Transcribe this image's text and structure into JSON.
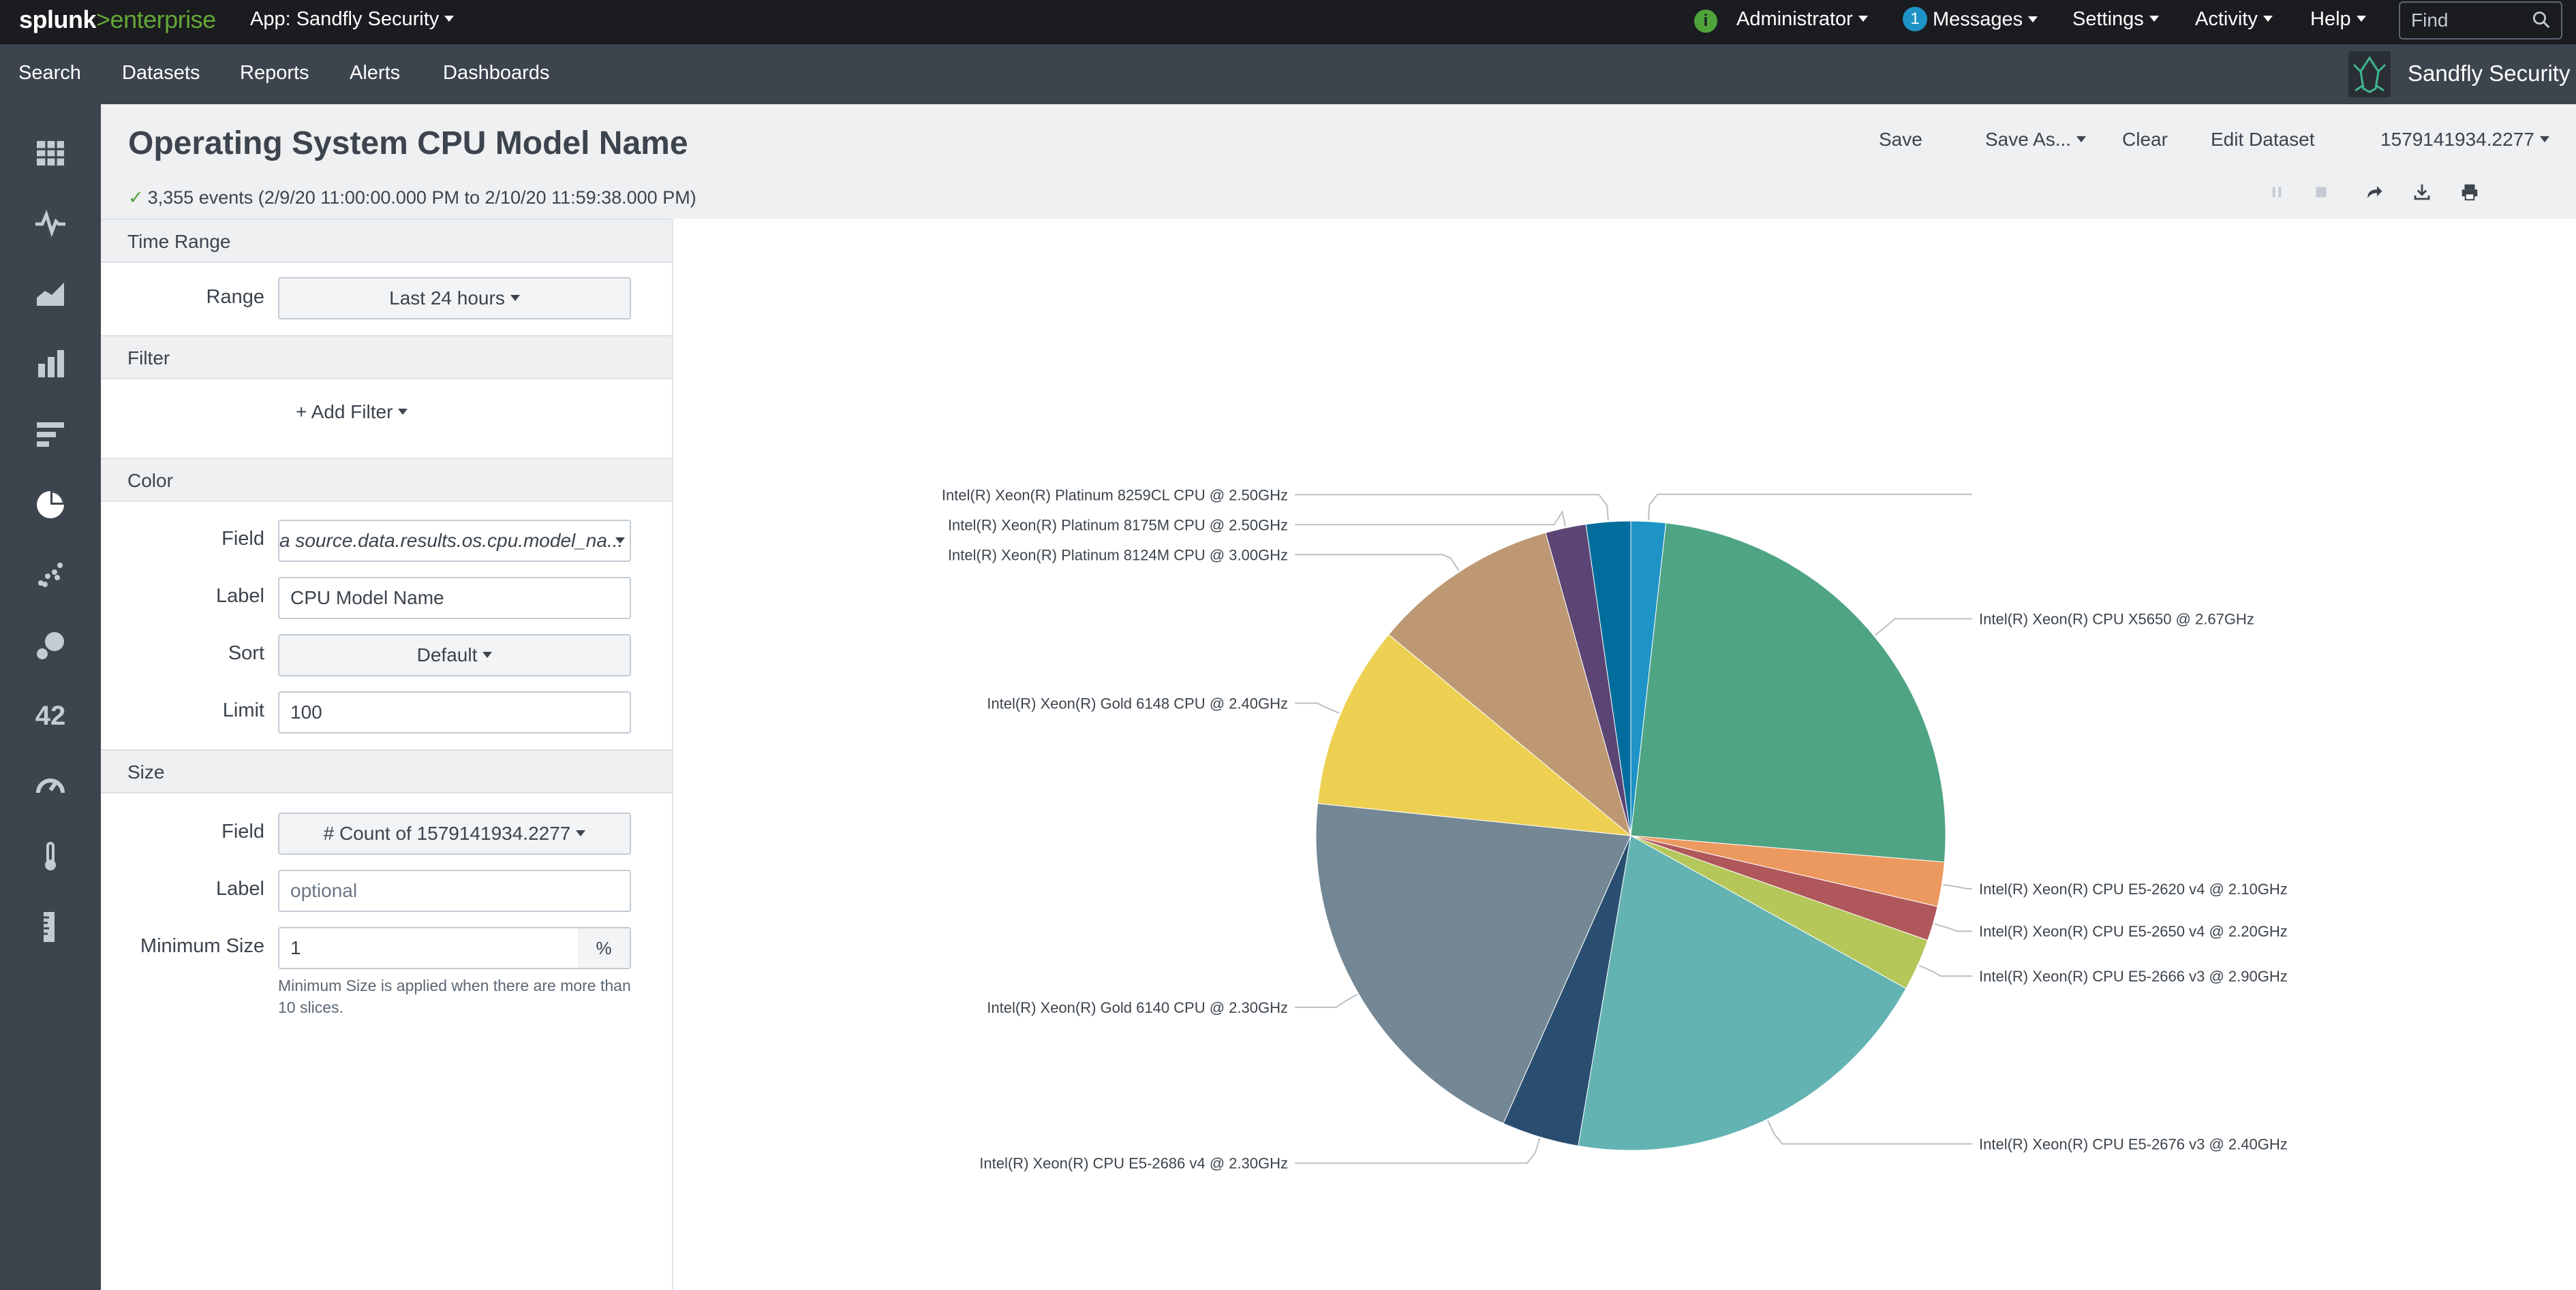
{
  "topbar": {
    "logo_part1": "splunk",
    "logo_part2": ">",
    "logo_part3": "enterprise",
    "app_label": "App: Sandfly Security",
    "user": "Administrator",
    "messages_count": "1",
    "messages": "Messages",
    "settings": "Settings",
    "activity": "Activity",
    "help": "Help",
    "find_placeholder": "Find"
  },
  "appbar": {
    "nav": [
      "Search",
      "Datasets",
      "Reports",
      "Alerts",
      "Dashboards"
    ],
    "app_name": "Sandfly Security"
  },
  "rail": {
    "icons": [
      "table-icon",
      "pulse-icon",
      "area-chart-icon",
      "bar-chart-icon",
      "horizontal-bar-icon",
      "pie-chart-icon",
      "scatter-icon",
      "bubble-icon",
      "single-value-icon",
      "gauge-icon",
      "thermometer-icon",
      "ruler-icon"
    ],
    "single_value_text": "42"
  },
  "header": {
    "title": "Operating System CPU Model Name",
    "events_text": "3,355 events (2/9/20 11:00:00.000 PM to 2/10/20 11:59:38.000 PM)",
    "save": "Save",
    "save_as": "Save As...",
    "clear": "Clear",
    "edit_dataset": "Edit Dataset",
    "dataset_id": "1579141934.2277"
  },
  "panel": {
    "time_range": {
      "heading": "Time Range",
      "range_label": "Range",
      "range_value": "Last 24 hours"
    },
    "filter": {
      "heading": "Filter",
      "add_filter": "+ Add Filter"
    },
    "color": {
      "heading": "Color",
      "field_label": "Field",
      "field_value": "a source.data.results.os.cpu.model_na...",
      "label_label": "Label",
      "label_value": "CPU Model Name",
      "sort_label": "Sort",
      "sort_value": "Default",
      "limit_label": "Limit",
      "limit_value": "100"
    },
    "size": {
      "heading": "Size",
      "field_label": "Field",
      "field_value": "# Count of 1579141934.2277",
      "label_label": "Label",
      "label_placeholder": "optional",
      "min_size_label": "Minimum Size",
      "min_size_value": "1",
      "min_size_unit": "%",
      "help_text": "Minimum Size is applied when there are more than 10 slices."
    }
  },
  "chart_data": {
    "type": "pie",
    "title": "",
    "slices": [
      {
        "label": "",
        "value": 1.8,
        "color": "#1e93c6"
      },
      {
        "label": "Intel(R) Xeon(R) CPU X5650 @ 2.67GHz",
        "value": 24.8,
        "color": "#4fa484"
      },
      {
        "label": "Intel(R) Xeon(R) CPU E5-2620 v4 @ 2.10GHz",
        "value": 2.3,
        "color": "#ec9960"
      },
      {
        "label": "Intel(R) Xeon(R) CPU E5-2650 v4 @ 2.20GHz",
        "value": 1.8,
        "color": "#af575a"
      },
      {
        "label": "Intel(R) Xeon(R) CPU E5-2666 v3 @ 2.90GHz",
        "value": 2.7,
        "color": "#b6c75a"
      },
      {
        "label": "Intel(R) Xeon(R) CPU E5-2676 v3 @ 2.40GHz",
        "value": 19.8,
        "color": "#62b3b2"
      },
      {
        "label": "Intel(R) Xeon(R) CPU E5-2686 v4 @ 2.30GHz",
        "value": 4.0,
        "color": "#294e70"
      },
      {
        "label": "Intel(R) Xeon(R) Gold 6140 CPU @ 2.30GHz",
        "value": 20.2,
        "color": "#738795"
      },
      {
        "label": "Intel(R) Xeon(R) Gold 6148 CPU @ 2.40GHz",
        "value": 9.5,
        "color": "#edd051"
      },
      {
        "label": "Intel(R) Xeon(R) Platinum 8124M CPU @ 3.00GHz",
        "value": 9.7,
        "color": "#bd9872"
      },
      {
        "label": "Intel(R) Xeon(R) Platinum 8175M CPU @ 2.50GHz",
        "value": 2.1,
        "color": "#5a4575"
      },
      {
        "label": "Intel(R) Xeon(R) Platinum 8259CL CPU @ 2.50GHz",
        "value": 2.3,
        "color": "#006d9c"
      }
    ]
  }
}
